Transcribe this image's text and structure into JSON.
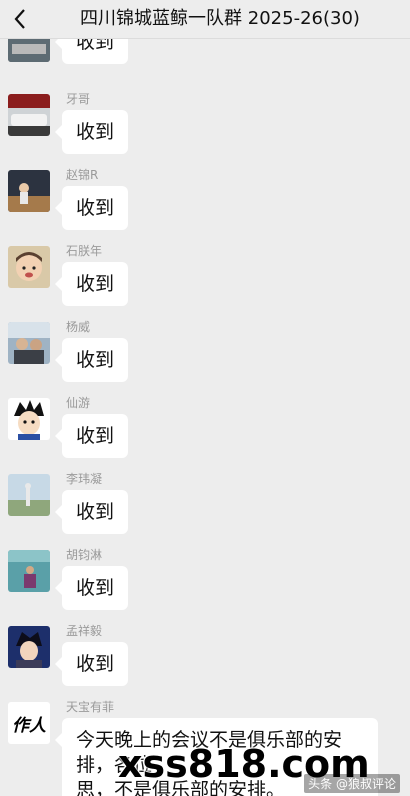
{
  "header": {
    "title": "四川锦城蓝鲸一队群 2025-26(30)",
    "more": "···"
  },
  "messages": [
    {
      "sender": "",
      "text": "收到",
      "avatar_icon": "car-photo-icon"
    },
    {
      "sender": "牙哥",
      "text": "收到",
      "avatar_icon": "car-photo-icon"
    },
    {
      "sender": "赵锦R",
      "text": "收到",
      "avatar_icon": "basketball-court-photo-icon"
    },
    {
      "sender": "石朕年",
      "text": "收到",
      "avatar_icon": "child-photo-icon"
    },
    {
      "sender": "杨威",
      "text": "收到",
      "avatar_icon": "couple-photo-icon"
    },
    {
      "sender": "仙游",
      "text": "收到",
      "avatar_icon": "anime-character-icon"
    },
    {
      "sender": "李玮凝",
      "text": "收到",
      "avatar_icon": "outdoor-photo-icon"
    },
    {
      "sender": "胡钧淋",
      "text": "收到",
      "avatar_icon": "seaside-photo-icon"
    },
    {
      "sender": "孟祥毅",
      "text": "收到",
      "avatar_icon": "anime-boy-icon"
    }
  ],
  "last_message": {
    "sender": "天宝有菲",
    "avatar_text": "作人",
    "lines": [
      "今天晚上的会议不是俱乐部的安",
      "排，各位",
      "思，不是俱乐部的安排。"
    ]
  },
  "overlay": {
    "watermark": "xss818.com",
    "credit": "头条 @狼叔评论"
  }
}
